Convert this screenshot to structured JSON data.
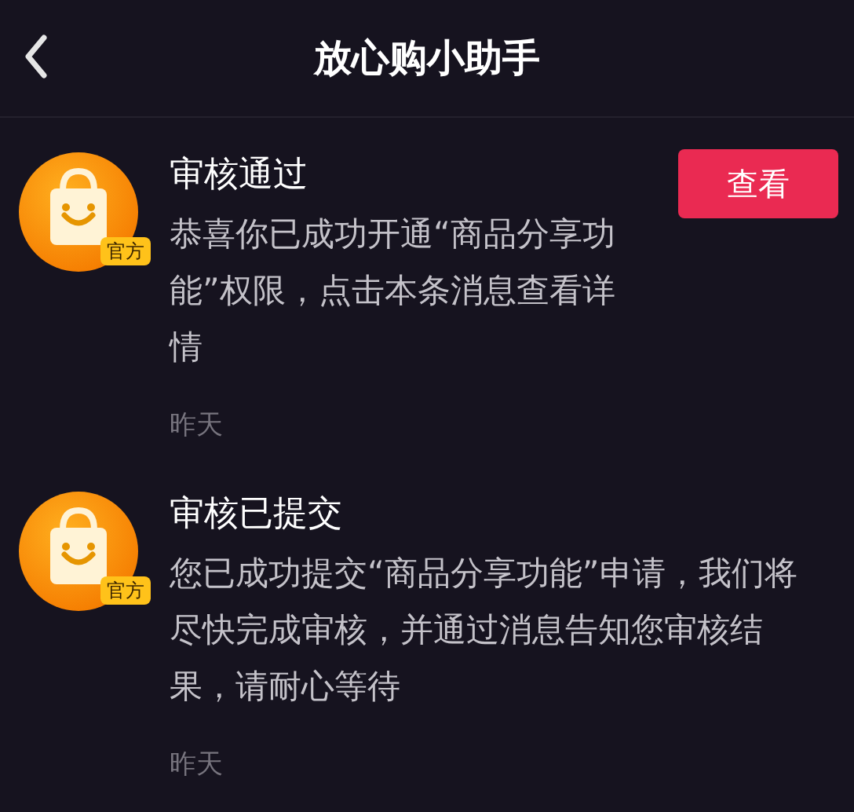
{
  "header": {
    "title": "放心购小助手"
  },
  "messages": [
    {
      "badge": "官方",
      "title": "审核通过",
      "body": "恭喜你已成功开通“商品分享功能”权限，点击本条消息查看详情",
      "time": "昨天",
      "action": "查看"
    },
    {
      "badge": "官方",
      "title": "审核已提交",
      "body": "您已成功提交“商品分享功能”申请，我们将尽快完成审核，并通过消息告知您审核结果，请耐心等待",
      "time": "昨天"
    }
  ]
}
